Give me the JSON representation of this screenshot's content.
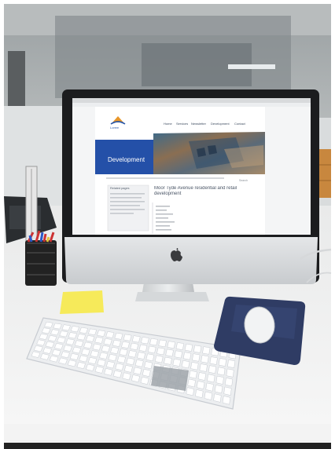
{
  "website": {
    "logo_text": "Lorem",
    "nav": [
      "Home",
      "Services",
      "Newsletter",
      "Development",
      "Contact"
    ],
    "banner_title": "Development",
    "search_label": "Search",
    "heading": "Moor Tyde Avenue residential and retail development",
    "sidebar_title": "Related pages",
    "colors": {
      "banner_blue": "#2450a8",
      "logo_orange": "#e8962a"
    }
  },
  "device_brand_icon": "apple-logo-icon",
  "keyboard_accent": "#c7cbd1",
  "mousepad_color": "#2f3c64"
}
